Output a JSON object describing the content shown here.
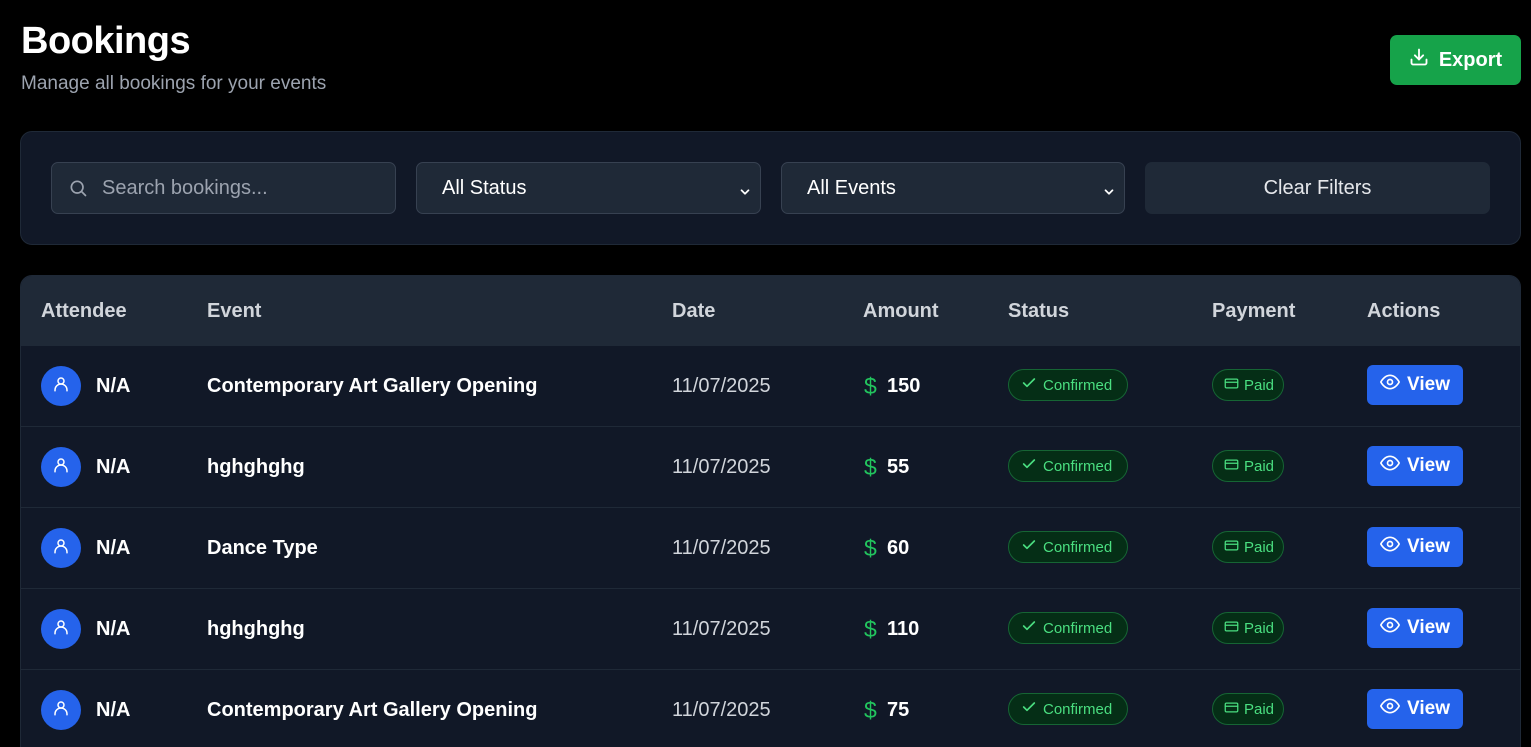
{
  "header": {
    "title": "Bookings",
    "subtitle": "Manage all bookings for your events",
    "export_label": "Export"
  },
  "filters": {
    "search_placeholder": "Search bookings...",
    "status_selected": "All Status",
    "events_selected": "All Events",
    "clear_label": "Clear Filters"
  },
  "table": {
    "columns": [
      "Attendee",
      "Event",
      "Date",
      "Amount",
      "Status",
      "Payment",
      "Actions"
    ],
    "currency_symbol": "$",
    "view_label": "View",
    "rows": [
      {
        "attendee": "N/A",
        "event": "Contemporary Art Gallery Opening",
        "date": "11/07/2025",
        "amount": "150",
        "status": "Confirmed",
        "payment": "Paid"
      },
      {
        "attendee": "N/A",
        "event": "hghghghg",
        "date": "11/07/2025",
        "amount": "55",
        "status": "Confirmed",
        "payment": "Paid"
      },
      {
        "attendee": "N/A",
        "event": "Dance Type",
        "date": "11/07/2025",
        "amount": "60",
        "status": "Confirmed",
        "payment": "Paid"
      },
      {
        "attendee": "N/A",
        "event": "hghghghg",
        "date": "11/07/2025",
        "amount": "110",
        "status": "Confirmed",
        "payment": "Paid"
      },
      {
        "attendee": "N/A",
        "event": "Contemporary Art Gallery Opening",
        "date": "11/07/2025",
        "amount": "75",
        "status": "Confirmed",
        "payment": "Paid"
      }
    ]
  },
  "colors": {
    "background": "#000000",
    "panel": "#111827",
    "export_green": "#16a34a",
    "view_blue": "#2563eb",
    "success_green": "#4ade80"
  },
  "icons": {
    "export": "download-icon",
    "search": "search-icon",
    "select": "chevron-down-icon",
    "avatar": "user-icon",
    "status": "check-icon",
    "payment": "credit-card-icon",
    "view": "eye-icon"
  }
}
